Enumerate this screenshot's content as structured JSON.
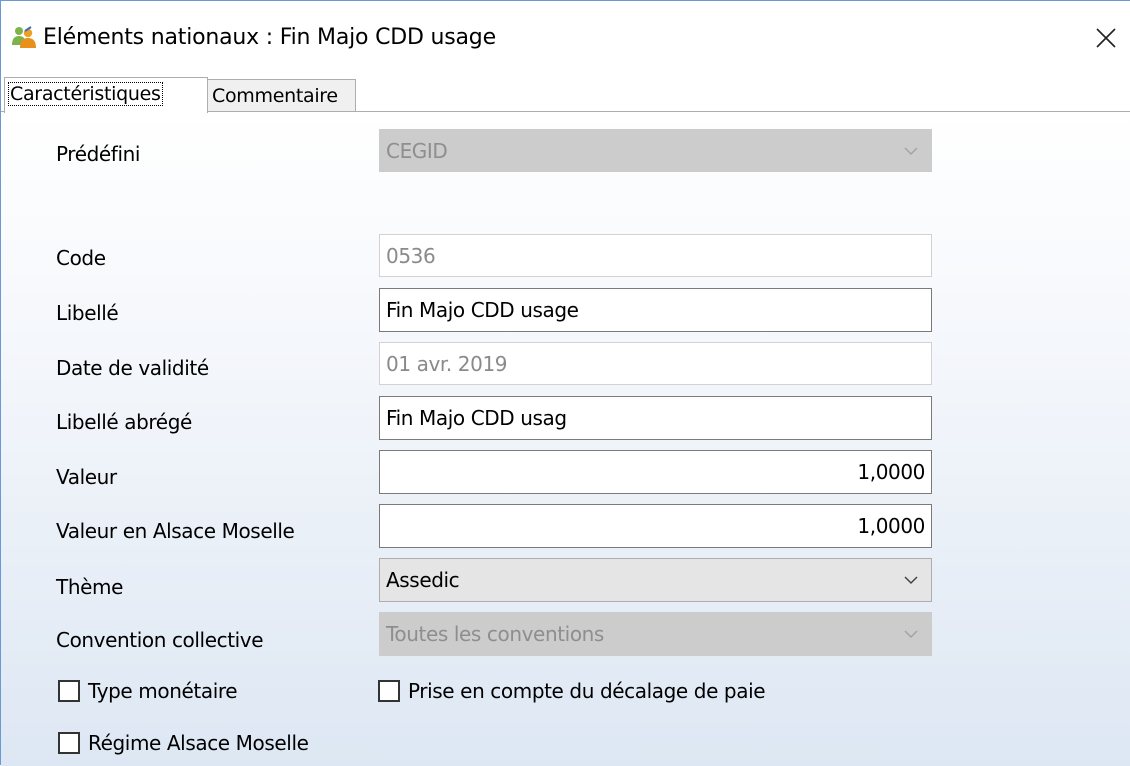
{
  "window": {
    "title": "Eléments nationaux : Fin Majo CDD usage"
  },
  "tabs": [
    {
      "label": "Caractéristiques",
      "active": true
    },
    {
      "label": "Commentaire",
      "active": false
    }
  ],
  "form": {
    "predefini": {
      "label": "Prédéfini",
      "value": "CEGID"
    },
    "code": {
      "label": "Code",
      "value": "0536"
    },
    "libelle": {
      "label": "Libellé",
      "value": "Fin Majo CDD usage"
    },
    "date_validite": {
      "label": "Date de validité",
      "value": "01 avr. 2019"
    },
    "libelle_abrege": {
      "label": "Libellé abrégé",
      "value": "Fin Majo CDD usag"
    },
    "valeur": {
      "label": "Valeur",
      "value": "1,0000"
    },
    "valeur_alsace": {
      "label": "Valeur en Alsace Moselle",
      "value": "1,0000"
    },
    "theme": {
      "label": "Thème",
      "value": "Assedic"
    },
    "convention": {
      "label": "Convention collective",
      "value": "Toutes les conventions"
    },
    "checkboxes": {
      "type_monetaire": {
        "label": "Type monétaire",
        "checked": false
      },
      "decalage_paie": {
        "label": "Prise en compte du décalage de paie",
        "checked": false
      },
      "regime_alsace": {
        "label": "Régime Alsace Moselle",
        "checked": false
      }
    }
  },
  "icons": {
    "app": "users-icon",
    "close": "close-icon",
    "dropdown": "chevron-down-icon"
  },
  "colors": {
    "window_border": "#6a9ad6",
    "disabled_combo": "#cccccc",
    "combo": "#e5e5e5"
  }
}
